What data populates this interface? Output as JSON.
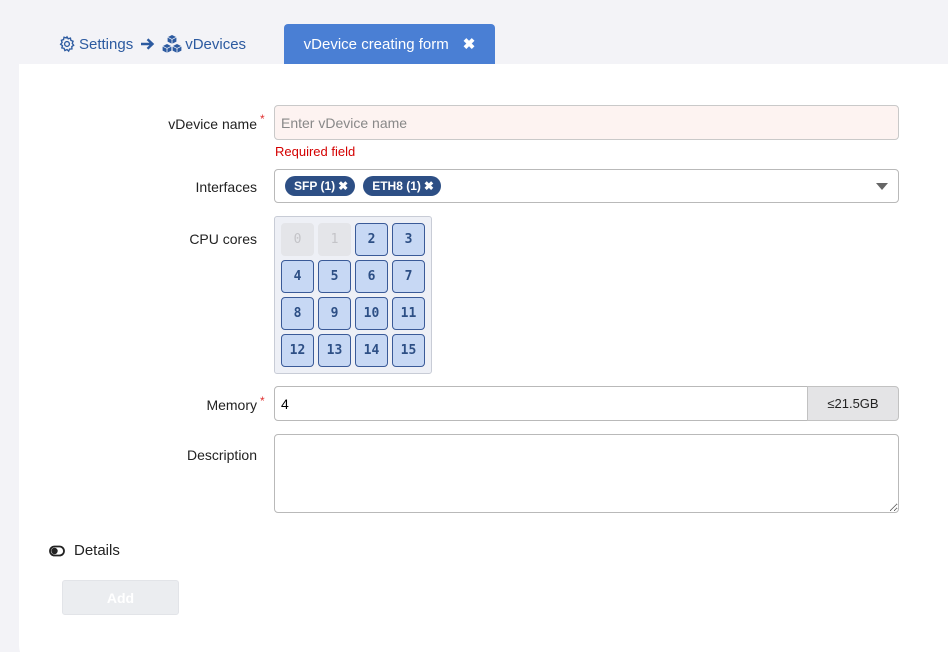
{
  "breadcrumb": {
    "settings_label": "Settings",
    "vdevices_label": "vDevices"
  },
  "tab": {
    "title": "vDevice creating form",
    "close": "✖"
  },
  "form": {
    "name": {
      "label": "vDevice name",
      "required_mark": "*",
      "placeholder": "Enter vDevice name",
      "value": "",
      "error": "Required field"
    },
    "interfaces": {
      "label": "Interfaces",
      "selected": [
        "SFP (1)",
        "ETH8 (1)"
      ],
      "remove_glyph": "✖"
    },
    "cpu": {
      "label": "CPU cores",
      "cores": [
        "0",
        "1",
        "2",
        "3",
        "4",
        "5",
        "6",
        "7",
        "8",
        "9",
        "10",
        "11",
        "12",
        "13",
        "14",
        "15"
      ],
      "disabled": [
        "0",
        "1"
      ]
    },
    "memory": {
      "label": "Memory",
      "required_mark": "*",
      "value": "4",
      "limit": "≤21.5GB"
    },
    "description": {
      "label": "Description",
      "value": ""
    }
  },
  "details": {
    "label": "Details"
  },
  "actions": {
    "add_label": "Add"
  },
  "colors": {
    "accent": "#4a7fd4",
    "chip": "#2d4f85",
    "error": "#d40000",
    "core_fill": "#c7d8f4"
  }
}
